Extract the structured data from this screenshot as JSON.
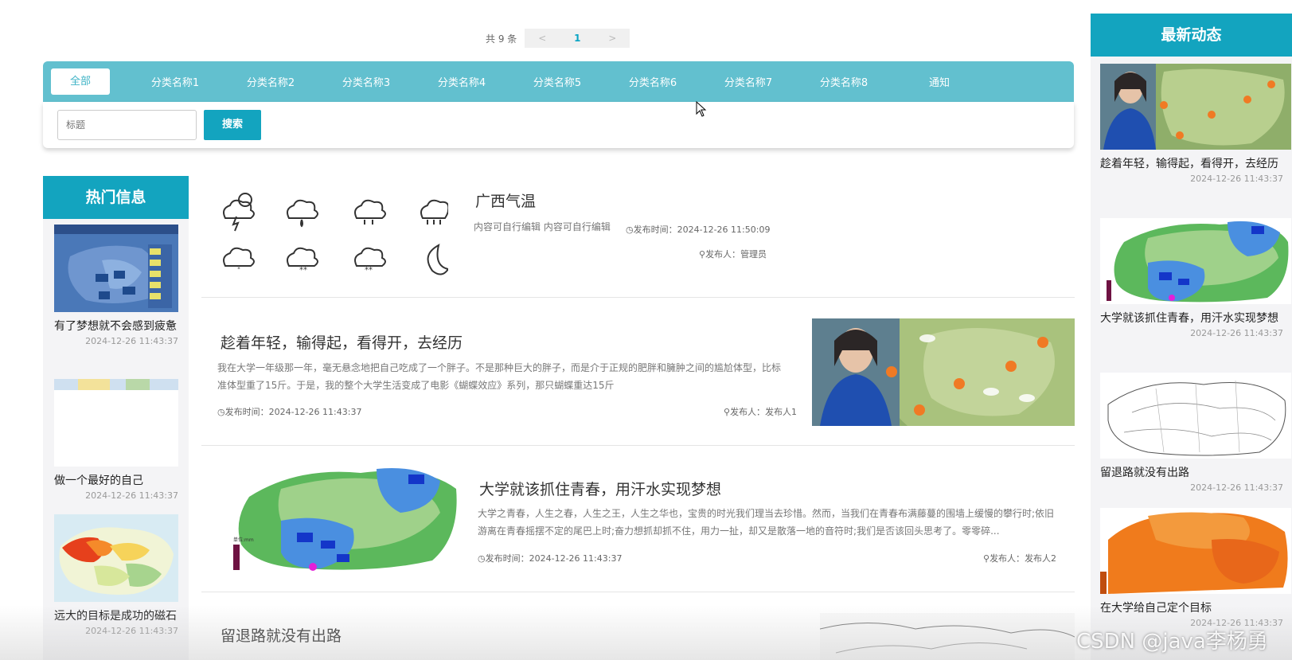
{
  "pager": {
    "total": "共 9 条",
    "prev": "<",
    "page": "1",
    "next": ">"
  },
  "categories": [
    "全部",
    "分类名称1",
    "分类名称2",
    "分类名称3",
    "分类名称4",
    "分类名称5",
    "分类名称6",
    "分类名称7",
    "分类名称8",
    "通知"
  ],
  "search": {
    "placeholder": "标题",
    "button": "搜索"
  },
  "hot": {
    "header": "热门信息",
    "items": [
      {
        "title": "有了梦想就不会感到疲惫",
        "date": "2024-12-26 11:43:37"
      },
      {
        "title": "做一个最好的自己",
        "date": "2024-12-26 11:43:37"
      },
      {
        "title": "远大的目标是成功的磁石",
        "date": "2024-12-26 11:43:37"
      }
    ]
  },
  "list": [
    {
      "title": "广西气温",
      "desc": "内容可自行编辑 内容可自行编辑",
      "time_label": "发布时间：",
      "time": "2024-12-26 11:50:09",
      "author_label": "发布人：",
      "author": "管理员"
    },
    {
      "title": "趁着年轻，输得起，看得开，去经历",
      "desc": "我在大学一年级那一年，毫无悬念地把自己吃成了一个胖子。不是那种巨大的胖子，而是介于正规的肥胖和臃肿之间的尴尬体型，比标准体型重了15斤。于是，我的整个大学生活变成了电影《蝴蝶效应》系列，那只蝴蝶重达15斤",
      "time_label": "发布时间：",
      "time": "2024-12-26 11:43:37",
      "author_label": "发布人：",
      "author": "发布人1"
    },
    {
      "title": "大学就该抓住青春，用汗水实现梦想",
      "desc": "大学之青春，人生之春，人生之王，人生之华也，宝贵的时光我们理当去珍惜。然而，当我们在青春布满藤蔓的围墙上缓慢的攀行时;依旧游离在青春摇摆不定的尾巴上时;奋力想抓却抓不住，用力一扯，却又是散落一地的音符时;我们是否该回头思考了。零零碎...",
      "time_label": "发布时间：",
      "time": "2024-12-26 11:43:37",
      "author_label": "发布人：",
      "author": "发布人2"
    },
    {
      "title": "留退路就没有出路"
    }
  ],
  "news": {
    "header": "最新动态",
    "items": [
      {
        "title": "趁着年轻，输得起，看得开，去经历",
        "date": "2024-12-26 11:43:37"
      },
      {
        "title": "大学就该抓住青春，用汗水实现梦想",
        "date": "2024-12-26 11:43:37"
      },
      {
        "title": "留退路就没有出路",
        "date": "2024-12-26 11:43:37"
      },
      {
        "title": "在大学给自己定个目标",
        "date": "2024-12-26 11:43:37"
      }
    ]
  },
  "watermark": "CSDN @java李杨勇"
}
